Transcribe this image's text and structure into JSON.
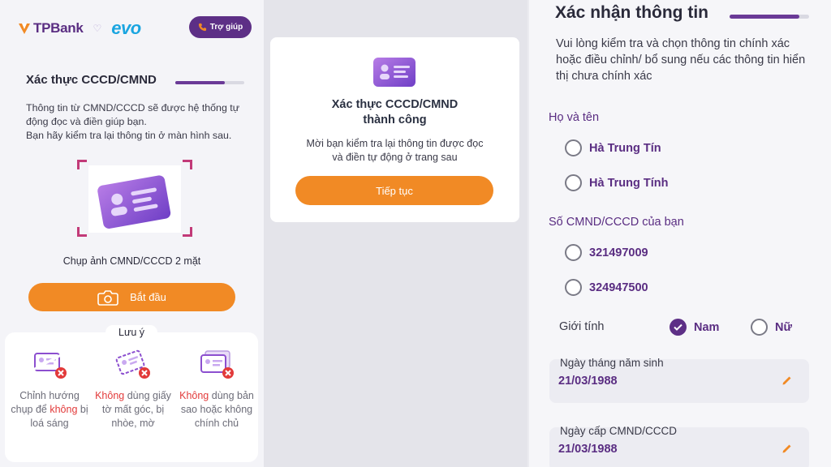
{
  "panel1": {
    "brand_left": "TPBank",
    "brand_right": "evo",
    "help_button": "Trợ giúp",
    "title": "Xác thực CCCD/CMND",
    "progress": 0.72,
    "desc_line1": "Thông tin từ CMND/CCCD sẽ được hệ thống tự động đọc và điền giúp bạn.",
    "desc_line2": "Bạn hãy kiểm tra lại thông tin ở màn hình sau.",
    "capture_label": "Chụp ảnh CMND/CCCD 2 mặt",
    "start_button": "Bắt đầu",
    "note_title": "Lưu ý",
    "notes": [
      {
        "pre": "Chỉnh hướng chụp để ",
        "red": "không",
        "post": " bị loá sáng"
      },
      {
        "pre": "",
        "red": "Không",
        "post": " dùng giấy tờ mất góc, bị nhòe, mờ"
      },
      {
        "pre": "",
        "red": "Không",
        "post": " dùng bản sao hoặc không chính chủ"
      }
    ]
  },
  "panel2": {
    "title_line1": "Xác thực CCCD/CMND",
    "title_line2": "thành công",
    "desc_line1": "Mời bạn kiểm tra lại thông tin được đọc",
    "desc_line2": "và điền tự động ở trang sau",
    "continue_button": "Tiếp tục"
  },
  "panel3": {
    "title": "Xác nhận thông tin",
    "progress": 0.88,
    "desc": "Vui lòng kiểm tra và chọn thông tin chính xác hoặc điều chỉnh/ bổ sung nếu các thông tin hiển thị chưa chính xác",
    "name_label": "Họ và tên",
    "name_options": [
      "Hà Trung Tín",
      "Hà Trung Tính"
    ],
    "id_label": "Số CMND/CCCD của bạn",
    "id_options": [
      "321497009",
      "324947500"
    ],
    "gender_label": "Giới tính",
    "gender_male": "Nam",
    "gender_female": "Nữ",
    "gender_selected": "Nam",
    "dob_label": "Ngày tháng năm sinh",
    "dob_value": "21/03/1988",
    "issue_label": "Ngày cấp CMND/CCCD",
    "issue_value": "21/03/1988"
  },
  "colors": {
    "brand_purple": "#5d2f86",
    "accent_orange": "#f18a25",
    "warning_red": "#e23a3a",
    "evo_blue": "#1aa5e0"
  }
}
